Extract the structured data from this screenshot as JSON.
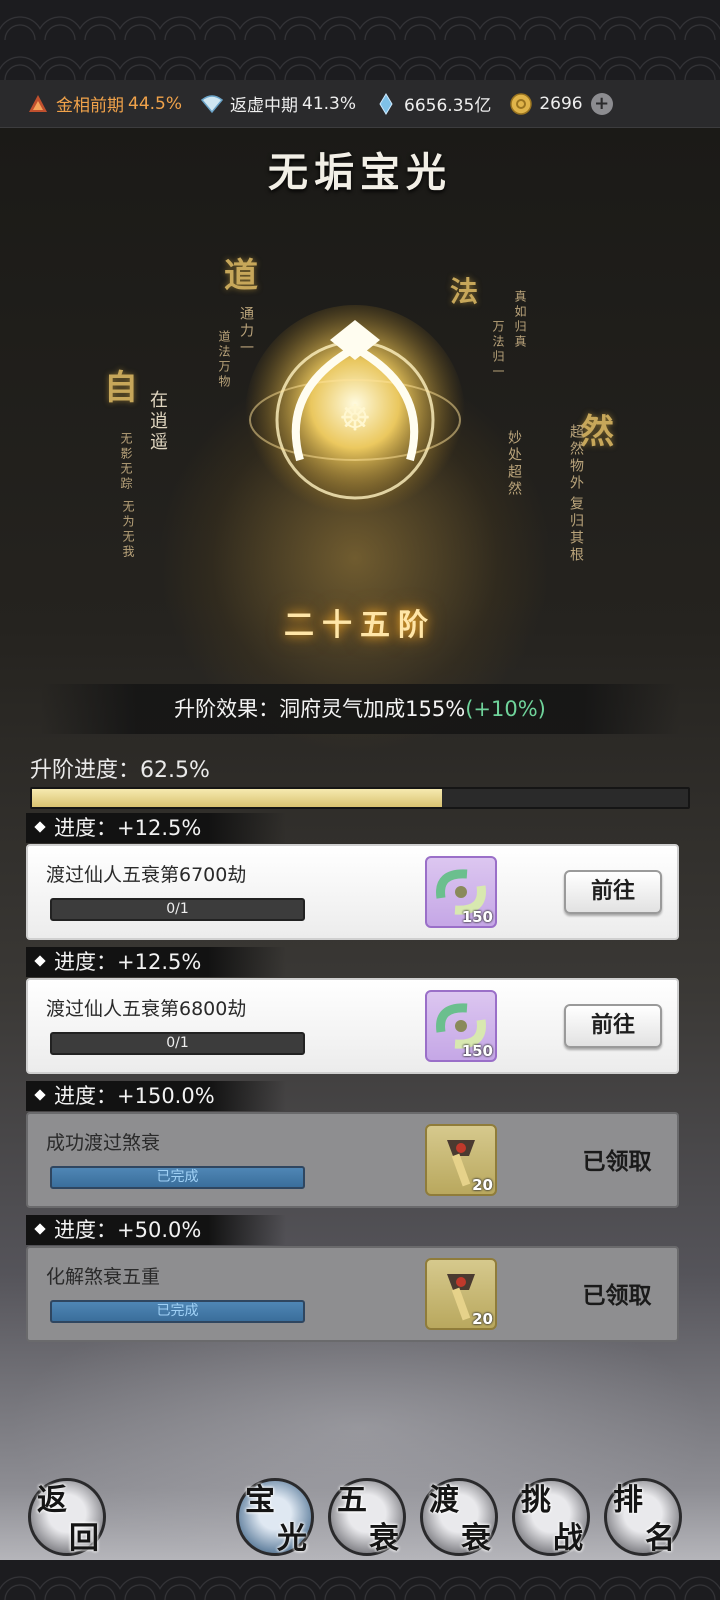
{
  "currency": {
    "stage1": {
      "label": "金相前期",
      "pct": "44.5%",
      "color": "#f0a24a"
    },
    "stage2": {
      "label": "返虚中期",
      "pct": "41.3%"
    },
    "spirit_stone": "6656.35亿",
    "coin": "2696"
  },
  "title": "无垢宝光",
  "calligraphy": {
    "dao": "道",
    "fa": "法",
    "zi": "自",
    "ran": "然",
    "zai_xiaoyao": "在逍遥",
    "wuying_wuzong": "无影无踪",
    "wuwei_wuwo": "无为无我",
    "tongli": "通力一",
    "daofa": "道法万物",
    "wanfa_guiyi": "万法归一",
    "chaoran": "超然物外",
    "fugui": "复归其根",
    "miaochu": "妙处超然",
    "zhengu": "真如归真"
  },
  "rank": "二十五阶",
  "effect": {
    "prefix": "升阶效果：洞府灵气加成155%",
    "gain": "(+10%)",
    "gain_color": "#6fd39a"
  },
  "progress": {
    "label": "升阶进度：62.5%",
    "value": 0.625
  },
  "tasks": [
    {
      "head": "进度：+12.5%",
      "name": "渡过仙人五衰第6700劫",
      "bar_text": "0/1",
      "reward_count": "150",
      "action": "前往"
    },
    {
      "head": "进度：+12.5%",
      "name": "渡过仙人五衰第6800劫",
      "bar_text": "0/1",
      "reward_count": "150",
      "action": "前往"
    },
    {
      "head": "进度：+150.0%",
      "name": "成功渡过煞衰",
      "bar_text": "已完成",
      "reward_count": "20",
      "action": "已领取"
    },
    {
      "head": "进度：+50.0%",
      "name": "化解煞衰五重",
      "bar_text": "已完成",
      "reward_count": "20",
      "action": "已领取"
    }
  ],
  "nav": [
    {
      "t1": "返",
      "t2": "回"
    },
    {
      "t1": "宝",
      "t2": "光"
    },
    {
      "t1": "五",
      "t2": "衰"
    },
    {
      "t1": "渡",
      "t2": "衰"
    },
    {
      "t1": "挑",
      "t2": "战"
    },
    {
      "t1": "排",
      "t2": "名"
    }
  ]
}
